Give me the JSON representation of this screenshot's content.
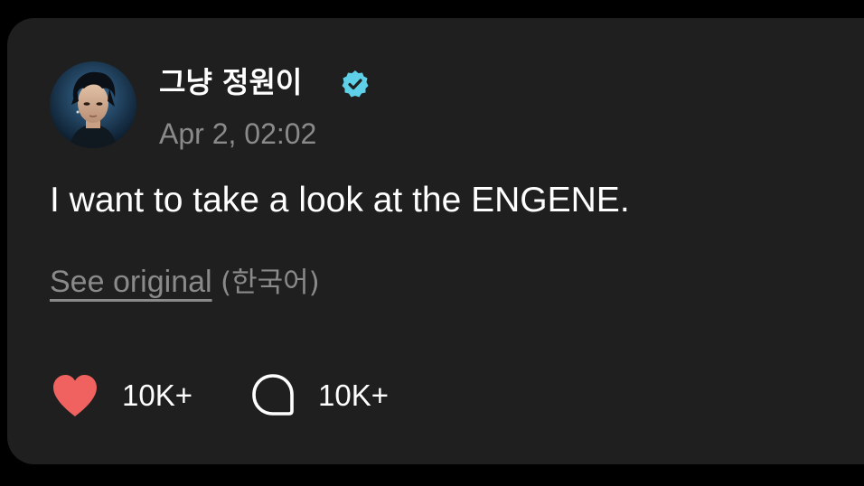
{
  "post": {
    "author_name": "그냥 정원이",
    "verified": true,
    "timestamp": "Apr 2, 02:02",
    "text": "I want to take a look at the ENGENE.",
    "see_original_label": "See original",
    "original_language": "(한국어)"
  },
  "actions": {
    "like_count": "10K+",
    "comment_count": "10K+"
  },
  "icons": {
    "like": "heart-icon",
    "comment": "comment-bubble-icon",
    "verified": "verified-badge-icon"
  },
  "colors": {
    "card_background": "#1f1f1f",
    "heart": "#f0625f",
    "verified_badge": "#5ed0e8",
    "muted_text": "#8a8a8a"
  }
}
